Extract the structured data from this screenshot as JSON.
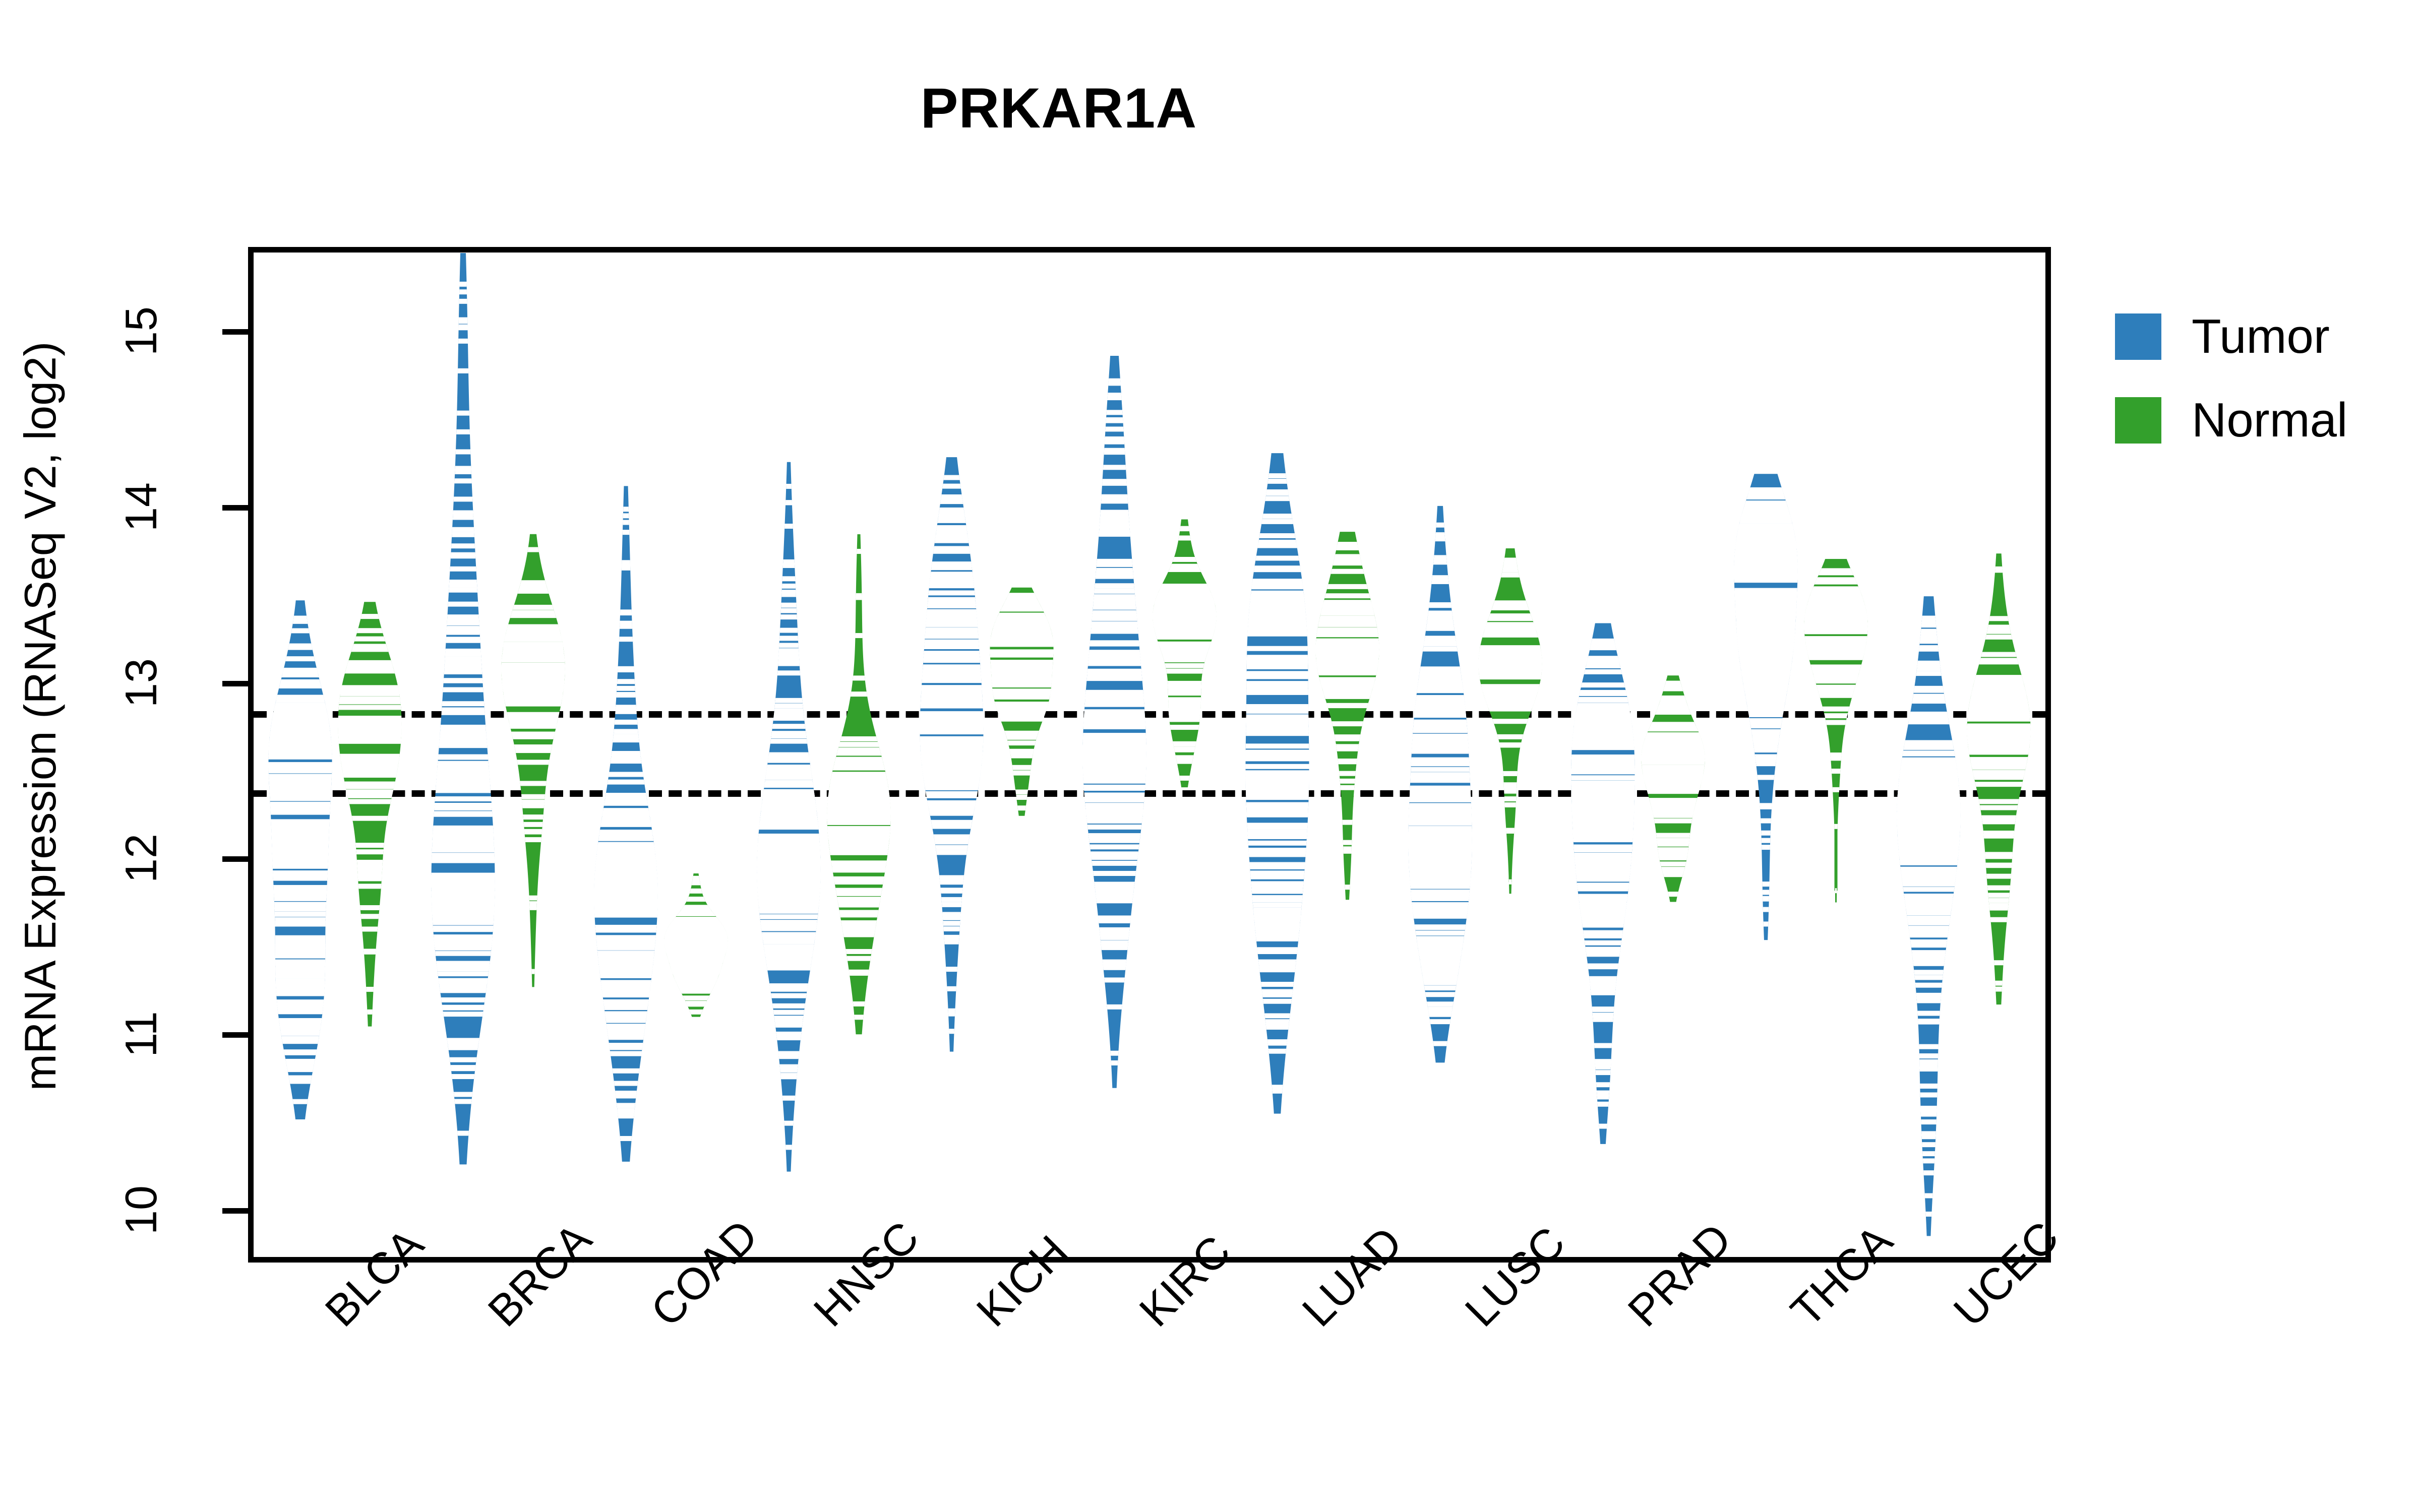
{
  "chart_data": {
    "type": "violin",
    "title": "PRKAR1A",
    "xlabel": "",
    "ylabel": "mRNA Expression (RNASeq V2, log2)",
    "ylim": [
      9.9,
      15.4
    ],
    "yticks": [
      10,
      11,
      12,
      13,
      14,
      15
    ],
    "ytick_labels": [
      "10",
      "11",
      "12",
      "13",
      "14",
      "15"
    ],
    "grid": false,
    "legend_position": "right",
    "reference_lines": [
      12.84,
      12.39
    ],
    "reference_line_style": "dotted",
    "categories": [
      "BLCA",
      "BRCA",
      "COAD",
      "HNSC",
      "KICH",
      "KIRC",
      "LUAD",
      "LUSC",
      "PRAD",
      "THCA",
      "UCEC"
    ],
    "series": [
      {
        "name": "Tumor",
        "color": "#2E7EBB",
        "medians": [
          12.05,
          12.5,
          11.77,
          12.08,
          12.77,
          12.79,
          12.78,
          12.27,
          12.15,
          13.27,
          12.08
        ],
        "mins": [
          10.62,
          10.44,
          10.41,
          10.36,
          11.02,
          10.84,
          10.68,
          10.95,
          10.48,
          11.63,
          9.98
        ],
        "maxes": [
          13.37,
          15.27,
          13.99,
          14.12,
          14.17,
          14.72,
          14.18,
          13.9,
          13.24,
          14.1,
          13.37
        ],
        "q1": [
          11.48,
          11.84,
          11.24,
          11.62,
          12.36,
          12.27,
          12.29,
          11.8,
          11.67,
          12.97,
          11.45
        ],
        "q3": [
          12.62,
          13.25,
          12.26,
          12.49,
          13.34,
          13.33,
          13.34,
          12.85,
          12.66,
          13.78,
          12.49
        ]
      },
      {
        "name": "Normal",
        "color": "#33A02C",
        "medians": [
          12.71,
          12.97,
          11.49,
          12.32,
          13.02,
          13.32,
          13.2,
          13.1,
          12.46,
          13.18,
          12.72
        ],
        "mins": [
          11.13,
          11.36,
          11.13,
          11.1,
          12.29,
          12.46,
          11.84,
          11.87,
          11.8,
          11.82,
          11.26
        ],
        "maxes": [
          13.38,
          13.76,
          11.89,
          13.75,
          13.5,
          13.88,
          13.79,
          13.7,
          13.0,
          13.64,
          13.65
        ],
        "q1": [
          12.36,
          12.71,
          11.36,
          12.11,
          12.8,
          13.1,
          12.98,
          12.88,
          12.27,
          12.95,
          12.48
        ],
        "q3": [
          12.95,
          13.25,
          11.62,
          12.62,
          13.23,
          13.5,
          13.44,
          13.32,
          12.7,
          13.38,
          13.0
        ]
      }
    ]
  },
  "title": "PRKAR1A",
  "axes": {
    "y_title": "mRNA Expression (RNASeq V2, log2)",
    "y_ticks": [
      "10",
      "11",
      "12",
      "13",
      "14",
      "15"
    ],
    "x_ticks": [
      "BLCA",
      "BRCA",
      "COAD",
      "HNSC",
      "KICH",
      "KIRC",
      "LUAD",
      "LUSC",
      "PRAD",
      "THCA",
      "UCEC"
    ]
  },
  "legend": {
    "items": [
      {
        "label": "Tumor",
        "color": "#2E7EBB"
      },
      {
        "label": "Normal",
        "color": "#33A02C"
      }
    ]
  }
}
